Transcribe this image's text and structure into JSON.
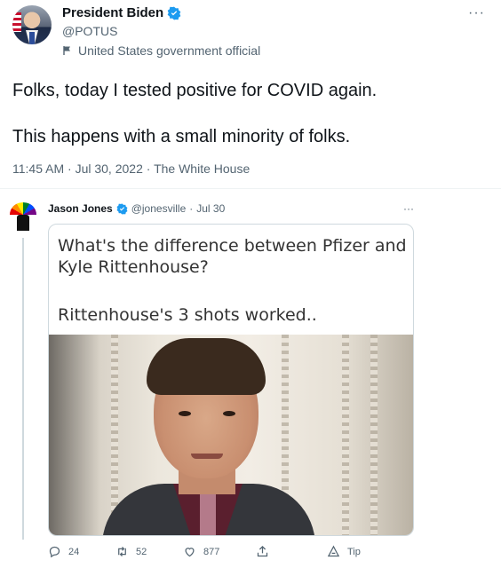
{
  "tweet": {
    "author_name": "President Biden",
    "handle": "@POTUS",
    "label": "United States government official",
    "more": "···",
    "text_line1": "Folks, today I tested positive for COVID again.",
    "text_line2": "This happens with a small minority of folks.",
    "time": "11:45 AM",
    "date": "Jul 30, 2022",
    "source": "The White House",
    "meta_sep": " · "
  },
  "reply": {
    "author_name": "Jason Jones",
    "handle": "@jonesville",
    "sep": "·",
    "date": "Jul 30",
    "more": "···",
    "meme_line1": "What's the difference between Pfizer and Kyle Rittenhouse?",
    "meme_line2": "Rittenhouse's 3 shots worked..",
    "actions": {
      "reply_count": "24",
      "retweet_count": "52",
      "like_count": "877",
      "tip_label": "Tip"
    }
  },
  "colors": {
    "verified": "#1d9bf0",
    "secondary_text": "#536471",
    "text": "#0f1419"
  },
  "icons": [
    "verified-icon",
    "flag-icon",
    "more-icon",
    "reply-icon",
    "retweet-icon",
    "like-icon",
    "share-icon",
    "tip-icon"
  ]
}
